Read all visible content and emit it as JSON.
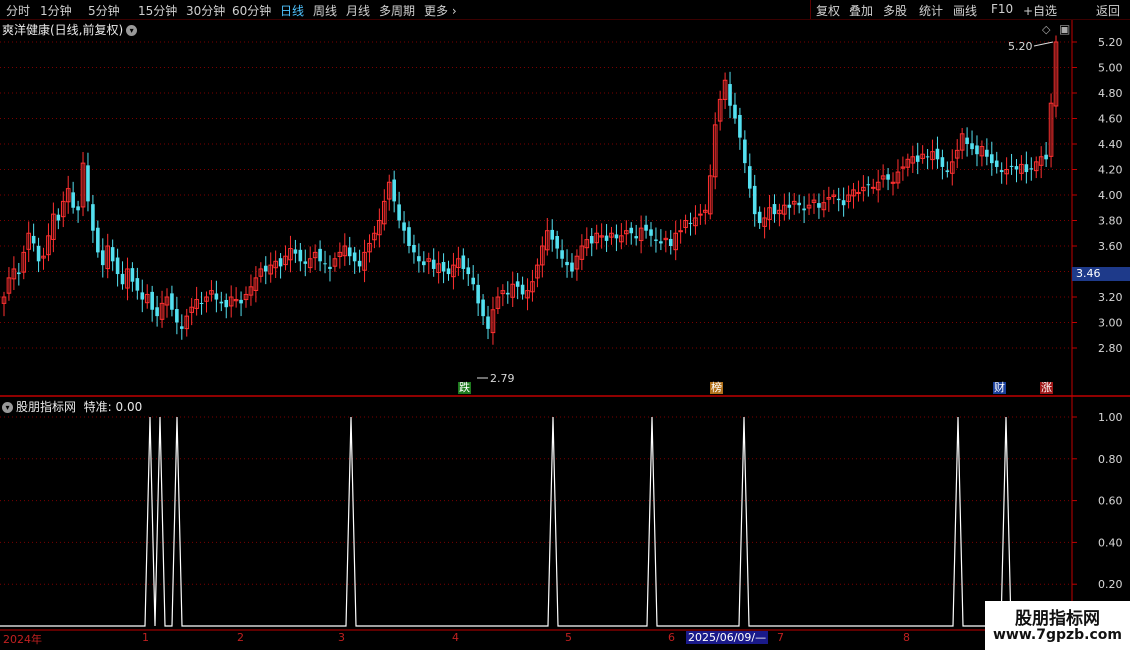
{
  "toolbar": {
    "periods": [
      "分时",
      "1分钟",
      "5分钟",
      "15分钟",
      "30分钟",
      "60分钟",
      "日线",
      "周线",
      "月线",
      "多周期",
      "更多"
    ],
    "active_period": "日线",
    "right_items": [
      "复权",
      "叠加",
      "多股",
      "统计",
      "画线",
      "F10",
      "+自选",
      "返回"
    ]
  },
  "main_chart": {
    "title": "爽洋健康(日线,前复权)",
    "y_ticks": [
      "5.20",
      "5.00",
      "4.80",
      "4.60",
      "4.40",
      "4.20",
      "4.00",
      "3.80",
      "3.60",
      "3.40",
      "3.20",
      "3.00",
      "2.80"
    ],
    "current_price": "3.46",
    "high_label": "5.20",
    "low_label": "2.79",
    "markers": [
      {
        "text": "跌",
        "color": "#1e7a1e"
      },
      {
        "text": "榜",
        "color": "#b0701a"
      },
      {
        "text": "财",
        "color": "#1a3f9a"
      },
      {
        "text": "涨",
        "color": "#a01818"
      }
    ]
  },
  "sub_chart": {
    "title": "股朋指标网",
    "indicator_label": "特准: 0.00",
    "y_ticks": [
      "1.00",
      "0.80",
      "0.60",
      "0.40",
      "0.20"
    ]
  },
  "date_axis": {
    "labels": [
      "2024年",
      "1",
      "2",
      "3",
      "4",
      "5",
      "6",
      "7",
      "8"
    ],
    "selected_date": "2025/06/09/—"
  },
  "watermark": {
    "line1": "股朋指标网",
    "line2": "www.7gpzb.com"
  },
  "colors": {
    "up": "#ff3030",
    "down": "#54e0f0",
    "grid": "#7a0000",
    "axis": "#c00000"
  },
  "chart_data": {
    "type": "candlestick",
    "ylim": [
      2.7,
      5.3
    ],
    "closes": [
      3.2,
      3.35,
      3.42,
      3.38,
      3.55,
      3.7,
      3.62,
      3.48,
      3.52,
      3.68,
      3.85,
      3.8,
      3.95,
      4.05,
      3.9,
      3.88,
      4.25,
      3.95,
      3.72,
      3.55,
      3.45,
      3.6,
      3.48,
      3.38,
      3.3,
      3.42,
      3.32,
      3.25,
      3.18,
      3.22,
      3.1,
      3.05,
      3.15,
      3.2,
      3.1,
      3.0,
      2.95,
      3.05,
      3.12,
      3.18,
      3.15,
      3.2,
      3.25,
      3.18,
      3.15,
      3.12,
      3.2,
      3.18,
      3.15,
      3.22,
      3.28,
      3.35,
      3.42,
      3.4,
      3.45,
      3.48,
      3.44,
      3.52,
      3.58,
      3.54,
      3.48,
      3.46,
      3.5,
      3.55,
      3.48,
      3.46,
      3.42,
      3.5,
      3.55,
      3.6,
      3.52,
      3.48,
      3.44,
      3.55,
      3.62,
      3.7,
      3.8,
      3.95,
      4.1,
      3.95,
      3.8,
      3.72,
      3.6,
      3.55,
      3.48,
      3.45,
      3.5,
      3.42,
      3.46,
      3.4,
      3.38,
      3.45,
      3.5,
      3.42,
      3.38,
      3.3,
      3.15,
      3.05,
      2.95,
      3.1,
      3.2,
      3.25,
      3.22,
      3.3,
      3.28,
      3.22,
      3.25,
      3.32,
      3.45,
      3.6,
      3.72,
      3.65,
      3.58,
      3.5,
      3.45,
      3.4,
      3.52,
      3.6,
      3.65,
      3.62,
      3.7,
      3.68,
      3.64,
      3.7,
      3.66,
      3.68,
      3.72,
      3.7,
      3.66,
      3.74,
      3.72,
      3.68,
      3.64,
      3.62,
      3.66,
      3.6,
      3.7,
      3.72,
      3.8,
      3.78,
      3.82,
      3.85,
      3.88,
      4.15,
      4.55,
      4.75,
      4.9,
      4.7,
      4.6,
      4.45,
      4.25,
      4.05,
      3.85,
      3.78,
      3.82,
      3.9,
      3.85,
      3.88,
      3.92,
      3.9,
      3.95,
      3.92,
      3.88,
      3.92,
      3.96,
      3.9,
      3.94,
      3.98,
      4.0,
      3.96,
      3.92,
      4.0,
      4.04,
      4.02,
      4.06,
      4.08,
      4.06,
      4.1,
      4.15,
      4.12,
      4.1,
      4.18,
      4.22,
      4.28,
      4.3,
      4.26,
      4.32,
      4.3,
      4.34,
      4.28,
      4.22,
      4.18,
      4.26,
      4.35,
      4.48,
      4.4,
      4.36,
      4.32,
      4.38,
      4.3,
      4.25,
      4.22,
      4.18,
      4.2,
      4.22,
      4.2,
      4.24,
      4.18,
      4.2,
      4.26,
      4.3,
      4.28,
      4.72,
      5.2
    ],
    "signals": [
      1,
      1,
      1,
      1,
      1,
      1,
      1,
      1,
      1,
      1
    ],
    "signal_note": "indicator spikes to 1.00 at ten bars, otherwise 0.00"
  }
}
